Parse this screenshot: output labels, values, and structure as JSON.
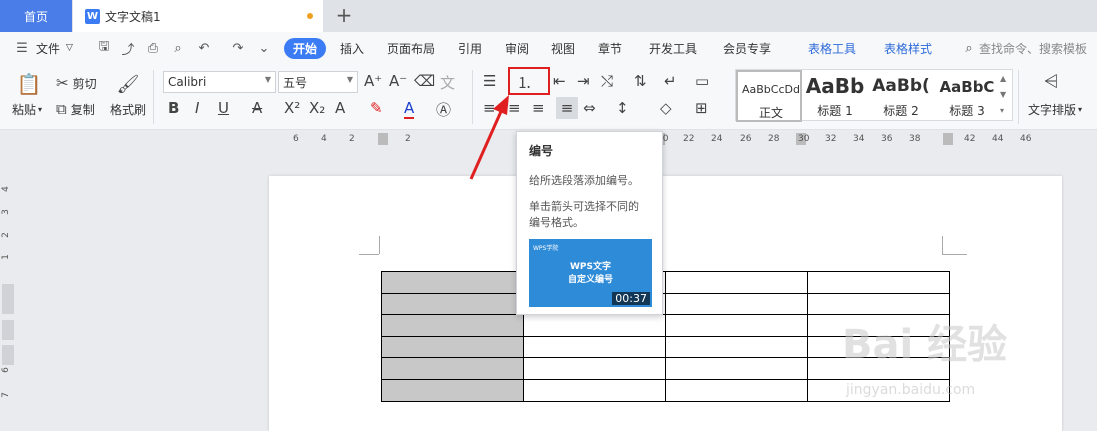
{
  "tabbar": {
    "home_tab": "首页",
    "doc_tab": "文字文稿1",
    "doc_icon": "W",
    "add_tab": "+"
  },
  "menubar": {
    "file": "文件",
    "items": [
      "开始",
      "插入",
      "页面布局",
      "引用",
      "审阅",
      "视图",
      "章节",
      "开发工具",
      "会员专享",
      "表格工具",
      "表格样式"
    ],
    "search_placeholder": "查找命令、搜索模板"
  },
  "ribbon": {
    "paste": "粘贴",
    "cut": "剪切",
    "copy": "复制",
    "format_painter": "格式刷",
    "font_name": "Calibri",
    "font_size": "五号",
    "styles": [
      {
        "sample": "AaBbCcDd",
        "name": "正文"
      },
      {
        "sample": "AaBb",
        "name": "标题 1"
      },
      {
        "sample": "AaBb(",
        "name": "标题 2"
      },
      {
        "sample": "AaBbC",
        "name": "标题 3"
      }
    ],
    "text_layout": "文字排版"
  },
  "ruler": {
    "ticks": [
      "6",
      "4",
      "2",
      "2",
      "20",
      "22",
      "24",
      "26",
      "28",
      "30",
      "32",
      "34",
      "36",
      "38",
      "42",
      "44",
      "46"
    ]
  },
  "vruler": {
    "ticks": [
      "4",
      "3",
      "2",
      "1",
      "1",
      "6",
      "7"
    ]
  },
  "tooltip": {
    "title": "编号",
    "line1": "给所选段落添加编号。",
    "line2": "单击箭头可选择不同的",
    "line3": "编号格式。",
    "video_logo": "WPS学院",
    "video_title_1": "WPS文字",
    "video_title_2": "自定义编号",
    "video_duration": "00:37"
  },
  "watermark": {
    "main": "Bai 经验",
    "sub": "jingyan.baidu.com"
  },
  "colors": {
    "accent": "#3b7cf5",
    "highlight_box": "#e02020",
    "table_selected": "#c8c8c8"
  }
}
